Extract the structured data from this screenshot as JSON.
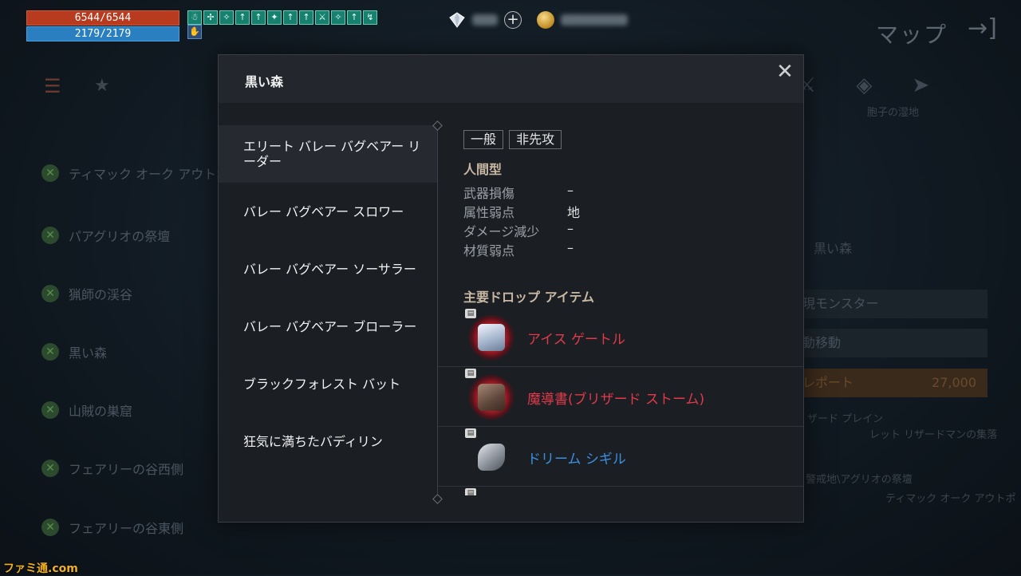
{
  "hud": {
    "hp": "6544/6544",
    "mp": "2179/2179",
    "buff_icons": [
      "☃",
      "✢",
      "✧",
      "↑",
      "↑",
      "✦",
      "↑",
      "↑",
      "⚔",
      "✧",
      "↑",
      "↯"
    ],
    "buff2_icon": "✋",
    "plus": "+",
    "map_title": "マップ",
    "map_exit": "→]"
  },
  "background": {
    "list": [
      "ティマック オーク アウトポスト",
      "パアグリオの祭壇",
      "猟師の渓谷",
      "黒い森",
      "山賊の巣窟",
      "フェアリーの谷西側",
      "フェアリーの谷東側"
    ],
    "right_labels": {
      "area": "胞子の湿地",
      "panel_title": "黒い森",
      "appearing_monsters": "現モンスター",
      "auto_move": "動移動",
      "teleport": "レポート",
      "teleport_cost": "27,000",
      "near1": "ザード プレイン",
      "near2": "レット リザードマンの集落",
      "near3": "警戒地\\アグリオの祭壇",
      "near4": "ティマック オーク アウトポ"
    }
  },
  "modal": {
    "title": "黒い森",
    "close": "✕",
    "monsters": [
      "エリート バレー バグベアー リーダー",
      "バレー バグベアー スロワー",
      "バレー バグベアー ソーサラー",
      "バレー バグベアー ブローラー",
      "ブラックフォレスト バット",
      "狂気に満ちたバディリン"
    ],
    "selected_index": 0,
    "tags": [
      "一般",
      "非先攻"
    ],
    "race": "人間型",
    "stats": [
      {
        "label": "武器損傷",
        "value": "–"
      },
      {
        "label": "属性弱点",
        "value": "地"
      },
      {
        "label": "ダメージ減少",
        "value": "–"
      },
      {
        "label": "材質弱点",
        "value": "–"
      }
    ],
    "drops_header": "主要ドロップ アイテム",
    "drops": [
      {
        "name": "アイス ゲートル",
        "rarity": "red",
        "icon": "gaiter-icon"
      },
      {
        "name": "魔導書(ブリザード ストーム)",
        "rarity": "red",
        "icon": "spellbook-icon"
      },
      {
        "name": "ドリーム シギル",
        "rarity": "blue",
        "icon": "sigil-icon"
      }
    ]
  },
  "watermark": "ファミ通.com",
  "colors": {
    "hp": "#b83a1f",
    "mp": "#2a7fc0",
    "red_item": "#e03a4a",
    "blue_item": "#3b8fe0"
  }
}
